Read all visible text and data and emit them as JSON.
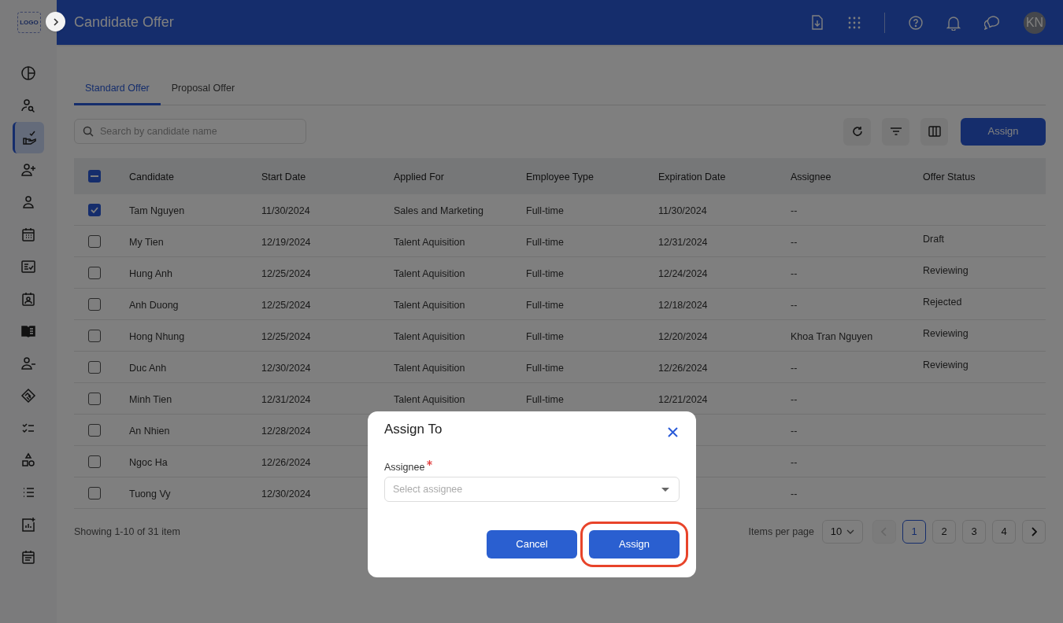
{
  "app": {
    "logo": "LOGO",
    "title": "Candidate Offer",
    "avatar": "KN"
  },
  "sidebar": {
    "items": [
      {
        "selected": false
      },
      {
        "selected": false
      },
      {
        "selected": true
      },
      {
        "selected": false
      },
      {
        "selected": false
      },
      {
        "selected": false
      },
      {
        "selected": false
      },
      {
        "selected": false
      },
      {
        "selected": false
      },
      {
        "selected": false
      },
      {
        "selected": false
      },
      {
        "selected": false
      },
      {
        "selected": false
      },
      {
        "selected": false
      },
      {
        "selected": false
      },
      {
        "selected": false
      }
    ]
  },
  "tabs": [
    {
      "label": "Standard Offer",
      "selected": true
    },
    {
      "label": "Proposal Offer",
      "selected": false
    }
  ],
  "search": {
    "placeholder": "Search by candidate name"
  },
  "toolbar": {
    "assign_button": "Assign"
  },
  "table": {
    "header_indeterminate": true,
    "columns": [
      "Candidate",
      "Start Date",
      "Applied For",
      "Employee Type",
      "Expiration Date",
      "Assignee",
      "Offer Status"
    ],
    "rows": [
      {
        "selected": true,
        "candidate": "Tam Nguyen",
        "start_date": "11/30/2024",
        "applied_for": "Sales and Marketing",
        "employee_type": "Full-time",
        "expiration_date": "11/30/2024",
        "assignee": "--"
      },
      {
        "selected": false,
        "candidate": "My Tien",
        "start_date": "12/19/2024",
        "applied_for": "Talent Aquisition",
        "employee_type": "Full-time",
        "expiration_date": "12/31/2024",
        "assignee": "--",
        "offer_status": "Draft"
      },
      {
        "selected": false,
        "candidate": "Hung Anh",
        "start_date": "12/25/2024",
        "applied_for": "Talent Aquisition",
        "employee_type": "Full-time",
        "expiration_date": "12/24/2024",
        "assignee": "--",
        "offer_status": "Reviewing"
      },
      {
        "selected": false,
        "candidate": "Anh Duong",
        "start_date": "12/25/2024",
        "applied_for": "Talent Aquisition",
        "employee_type": "Full-time",
        "expiration_date": "12/18/2024",
        "assignee": "--",
        "offer_status": "Rejected"
      },
      {
        "selected": false,
        "candidate": "Hong Nhung",
        "start_date": "12/25/2024",
        "applied_for": "Talent Aquisition",
        "employee_type": "Full-time",
        "expiration_date": "12/20/2024",
        "assignee": "Khoa Tran Nguyen",
        "offer_status": "Reviewing"
      },
      {
        "selected": false,
        "candidate": "Duc Anh",
        "start_date": "12/30/2024",
        "applied_for": "Talent Aquisition",
        "employee_type": "Full-time",
        "expiration_date": "12/26/2024",
        "assignee": "--",
        "offer_status": "Reviewing"
      },
      {
        "selected": false,
        "candidate": "Minh Tien",
        "start_date": "12/31/2024",
        "applied_for": "Talent Aquisition",
        "employee_type": "Full-time",
        "expiration_date": "12/21/2024",
        "assignee": "--"
      },
      {
        "selected": false,
        "candidate": "An Nhien",
        "start_date": "12/28/2024",
        "assignee": "--"
      },
      {
        "selected": false,
        "candidate": "Ngoc Ha",
        "start_date": "12/26/2024",
        "assignee": "--"
      },
      {
        "selected": false,
        "candidate": "Tuong Vy",
        "start_date": "12/30/2024",
        "assignee": "--"
      }
    ]
  },
  "footer": {
    "showing": "Showing 1-10 of 31 item",
    "per_page_label": "Items per page",
    "per_page": "10",
    "prev_disabled": true,
    "pages": [
      {
        "label": "1",
        "selected": true
      },
      {
        "label": "2",
        "selected": false
      },
      {
        "label": "3",
        "selected": false
      },
      {
        "label": "4",
        "selected": false
      }
    ]
  },
  "dialog": {
    "title": "Assign To",
    "field_label": "Assignee",
    "required": true,
    "placeholder": "Select assignee",
    "cancel": "Cancel",
    "confirm": "Assign",
    "confirm_highlighted": true
  }
}
